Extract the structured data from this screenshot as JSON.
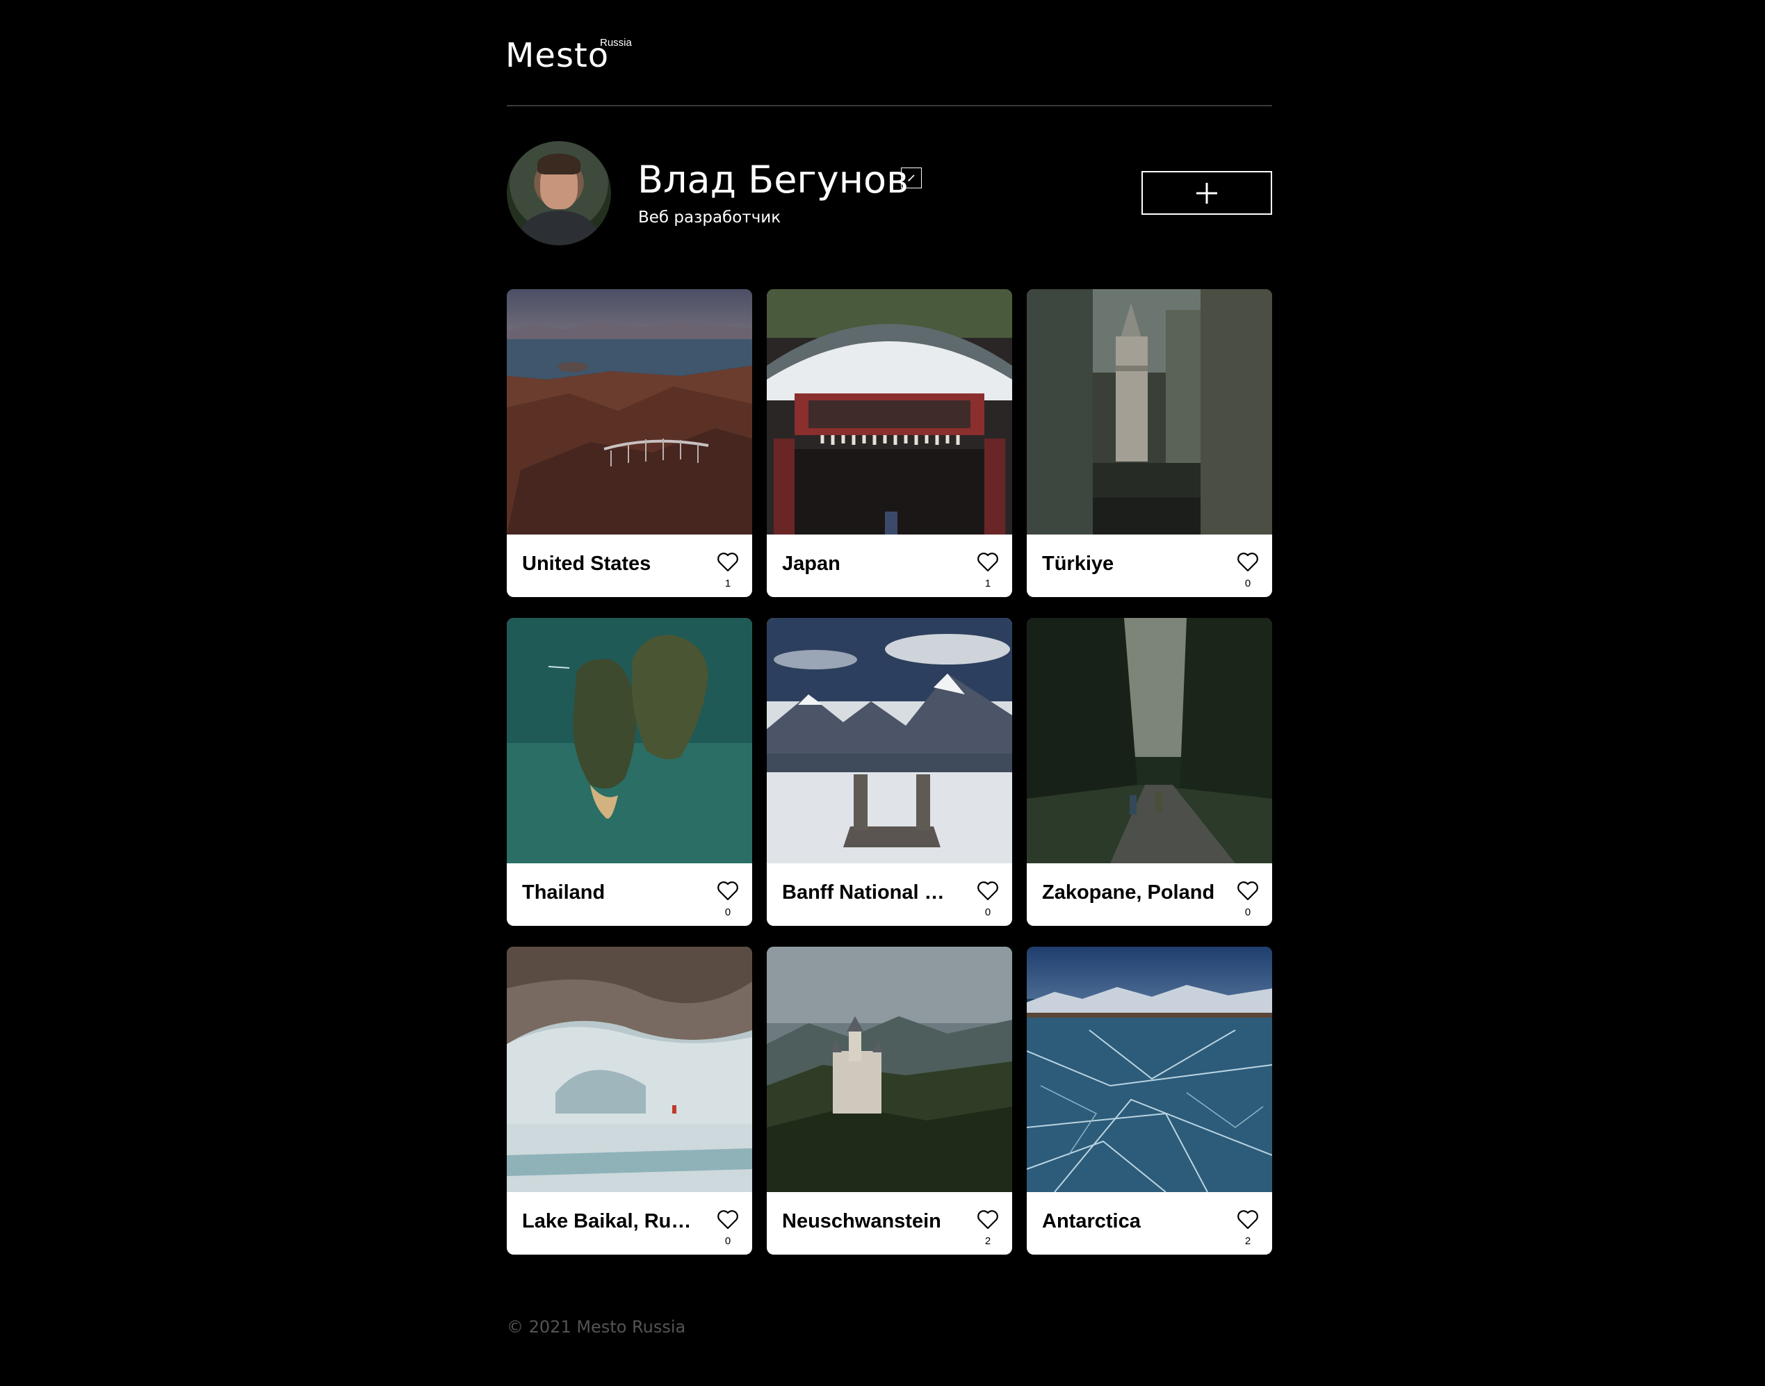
{
  "header": {
    "logo": "Mesto",
    "logo_sup": "Russia"
  },
  "profile": {
    "name": "Влад Бегунов",
    "about": "Веб разработчик"
  },
  "cards": [
    {
      "title": "United States",
      "likes": "1"
    },
    {
      "title": "Japan",
      "likes": "1"
    },
    {
      "title": "Türkiye",
      "likes": "0"
    },
    {
      "title": "Thailand",
      "likes": "0"
    },
    {
      "title": "Banff National Park",
      "likes": "0"
    },
    {
      "title": "Zakopane, Poland",
      "likes": "0"
    },
    {
      "title": "Lake Baikal, Russia",
      "likes": "0"
    },
    {
      "title": "Neuschwanstein",
      "likes": "2"
    },
    {
      "title": "Antarctica",
      "likes": "2"
    }
  ],
  "footer": {
    "copyright": "© 2021 Mesto Russia"
  },
  "icons": {
    "edit": "edit-icon",
    "add": "plus-icon",
    "like": "heart-icon"
  },
  "colors": {
    "background": "#000000",
    "card": "#ffffff",
    "footer_text": "#545454"
  }
}
